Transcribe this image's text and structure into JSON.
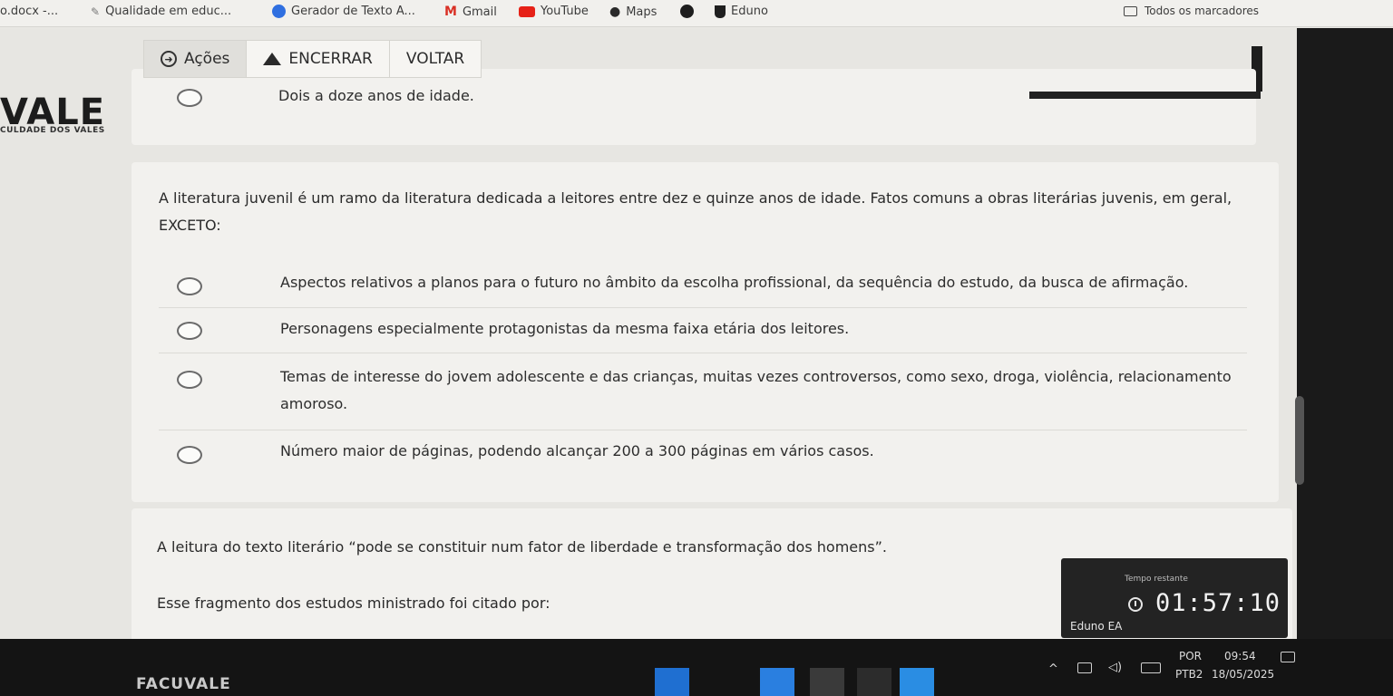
{
  "bookmarks": {
    "items": [
      {
        "label": "o.docx -...",
        "icon": "doc-icon",
        "color": "#8a8a8a"
      },
      {
        "label": "Qualidade em educ...",
        "icon": "feather-icon",
        "color": "#8a8a8a"
      },
      {
        "label": "Gerador de Texto A...",
        "icon": "gerador-icon",
        "color": "#2f6fe0"
      },
      {
        "label": "Gmail",
        "icon": "gmail-icon",
        "color": "#d93025"
      },
      {
        "label": "YouTube",
        "icon": "youtube-icon",
        "color": "#e62117"
      },
      {
        "label": "Maps",
        "icon": "maps-pin-icon",
        "color": "#2a2a2a"
      },
      {
        "label": "",
        "icon": "circle-logo-icon",
        "color": "#1e1e1e"
      },
      {
        "label": "Eduno",
        "icon": "eduno-icon",
        "color": "#1f1f1f"
      }
    ],
    "all_bookmarks": "Todos os marcadores"
  },
  "brand": {
    "logo": "VALE",
    "logo_sub": "CULDADE DOS VALES",
    "footer": "FACUVALE"
  },
  "toolbar": {
    "actions": "Ações",
    "end": "ENCERRAR",
    "back": "VOLTAR"
  },
  "question1": {
    "option": "Dois a doze anos de idade."
  },
  "question2": {
    "stem_line1": "A literatura juvenil é um ramo da literatura dedicada a leitores entre dez e quinze anos de idade. Fatos comuns a obras literárias juvenis, em geral,",
    "stem_line2": "EXCETO:",
    "options": [
      {
        "line1": "Aspectos relativos a planos para o futuro no âmbito da escolha profissional, da sequência do estudo, da busca de afirmação.",
        "line2": ""
      },
      {
        "line1": "Personagens especialmente protagonistas da mesma faixa etária dos leitores.",
        "line2": ""
      },
      {
        "line1": "Temas de interesse do jovem adolescente e das crianças, muitas vezes controversos, como sexo, droga, violência, relacionamento",
        "line2": "amoroso."
      },
      {
        "line1": "Número maior de páginas, podendo alcançar 200 a 300 páginas em vários casos.",
        "line2": ""
      }
    ]
  },
  "question3": {
    "stem_line1": "A leitura do texto literário “pode se constituir num fator de liberdade e transformação dos homens”.",
    "stem_line2": "Esse fragmento dos estudos ministrado foi citado por:"
  },
  "timer": {
    "label": "Tempo restante",
    "brand": "Eduno EA",
    "value": "01:57:10"
  },
  "system_tray": {
    "lang1": "POR",
    "lang2": "PTB2",
    "time": "09:54",
    "date": "18/05/2025"
  }
}
